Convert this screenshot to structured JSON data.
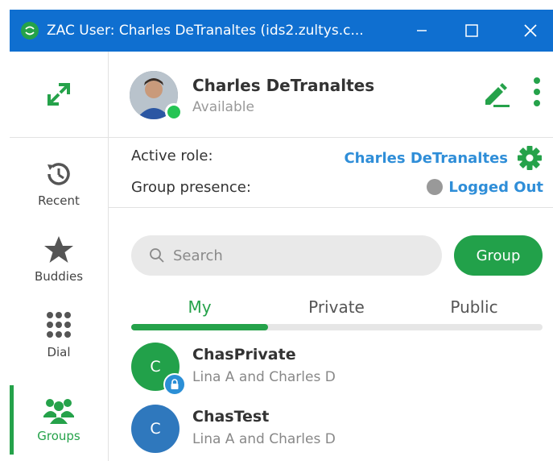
{
  "window": {
    "title": "ZAC User: Charles DeTranaltes (ids2.zultys.c...",
    "app_icon_text": "zultys"
  },
  "sidebar": {
    "items": [
      {
        "label": "Recent",
        "icon": "clock-history-icon"
      },
      {
        "label": "Buddies",
        "icon": "star-icon"
      },
      {
        "label": "Dial",
        "icon": "dialpad-icon"
      },
      {
        "label": "Groups",
        "icon": "people-group-icon",
        "active": true
      }
    ]
  },
  "profile": {
    "name": "Charles DeTranaltes",
    "status": "Available"
  },
  "roles": {
    "active_role_label": "Active role:",
    "active_role_value": "Charles DeTranaltes",
    "group_presence_label": "Group presence:",
    "group_presence_value": "Logged Out"
  },
  "search": {
    "placeholder": "Search",
    "value": ""
  },
  "group_button_label": "Group",
  "tabs": [
    {
      "label": "My",
      "active": true
    },
    {
      "label": "Private"
    },
    {
      "label": "Public"
    }
  ],
  "groups": [
    {
      "initial": "C",
      "name": "ChasPrivate",
      "members": "Lina A and Charles D",
      "locked": true,
      "color": "#22a14a"
    },
    {
      "initial": "C",
      "name": "ChasTest",
      "members": "Lina A and Charles D",
      "locked": false,
      "color": "#2f78bd"
    }
  ],
  "colors": {
    "titlebar": "#0f6fd0",
    "accent_green": "#25a24a",
    "link_blue": "#2f8ed8"
  }
}
